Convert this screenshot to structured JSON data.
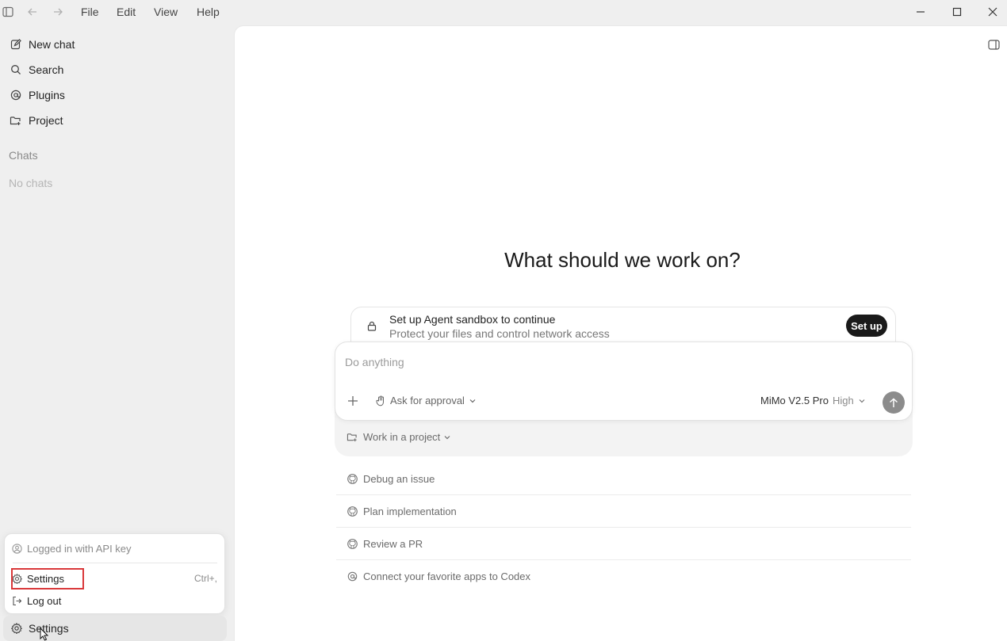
{
  "menu": {
    "file": "File",
    "edit": "Edit",
    "view": "View",
    "help": "Help"
  },
  "sidebar": {
    "items": [
      {
        "label": "New chat",
        "icon": "edit-icon"
      },
      {
        "label": "Search",
        "icon": "search-icon"
      },
      {
        "label": "Plugins",
        "icon": "at-icon"
      },
      {
        "label": "Project",
        "icon": "folder-plus-icon"
      }
    ],
    "chats_heading": "Chats",
    "chats_empty": "No chats",
    "bottom_settings": "Settings"
  },
  "account_menu": {
    "status": "Logged in with API key",
    "settings": "Settings",
    "settings_shortcut": "Ctrl+,",
    "logout": "Log out",
    "highlight_color": "#d9383a"
  },
  "main": {
    "heading": "What should we work on?",
    "sandbox": {
      "title": "Set up Agent sandbox to continue",
      "subtitle": "Protect your files and control network access",
      "button": "Set up"
    },
    "composer": {
      "placeholder": "Do anything",
      "approval": "Ask for approval",
      "model": "MiMo V2.5 Pro",
      "effort": "High"
    },
    "project": "Work in a project",
    "suggestions": [
      {
        "label": "Debug an issue",
        "icon": "github-icon"
      },
      {
        "label": "Plan implementation",
        "icon": "github-icon"
      },
      {
        "label": "Review a PR",
        "icon": "github-icon"
      },
      {
        "label": "Connect your favorite apps to Codex",
        "icon": "at-icon"
      }
    ]
  }
}
